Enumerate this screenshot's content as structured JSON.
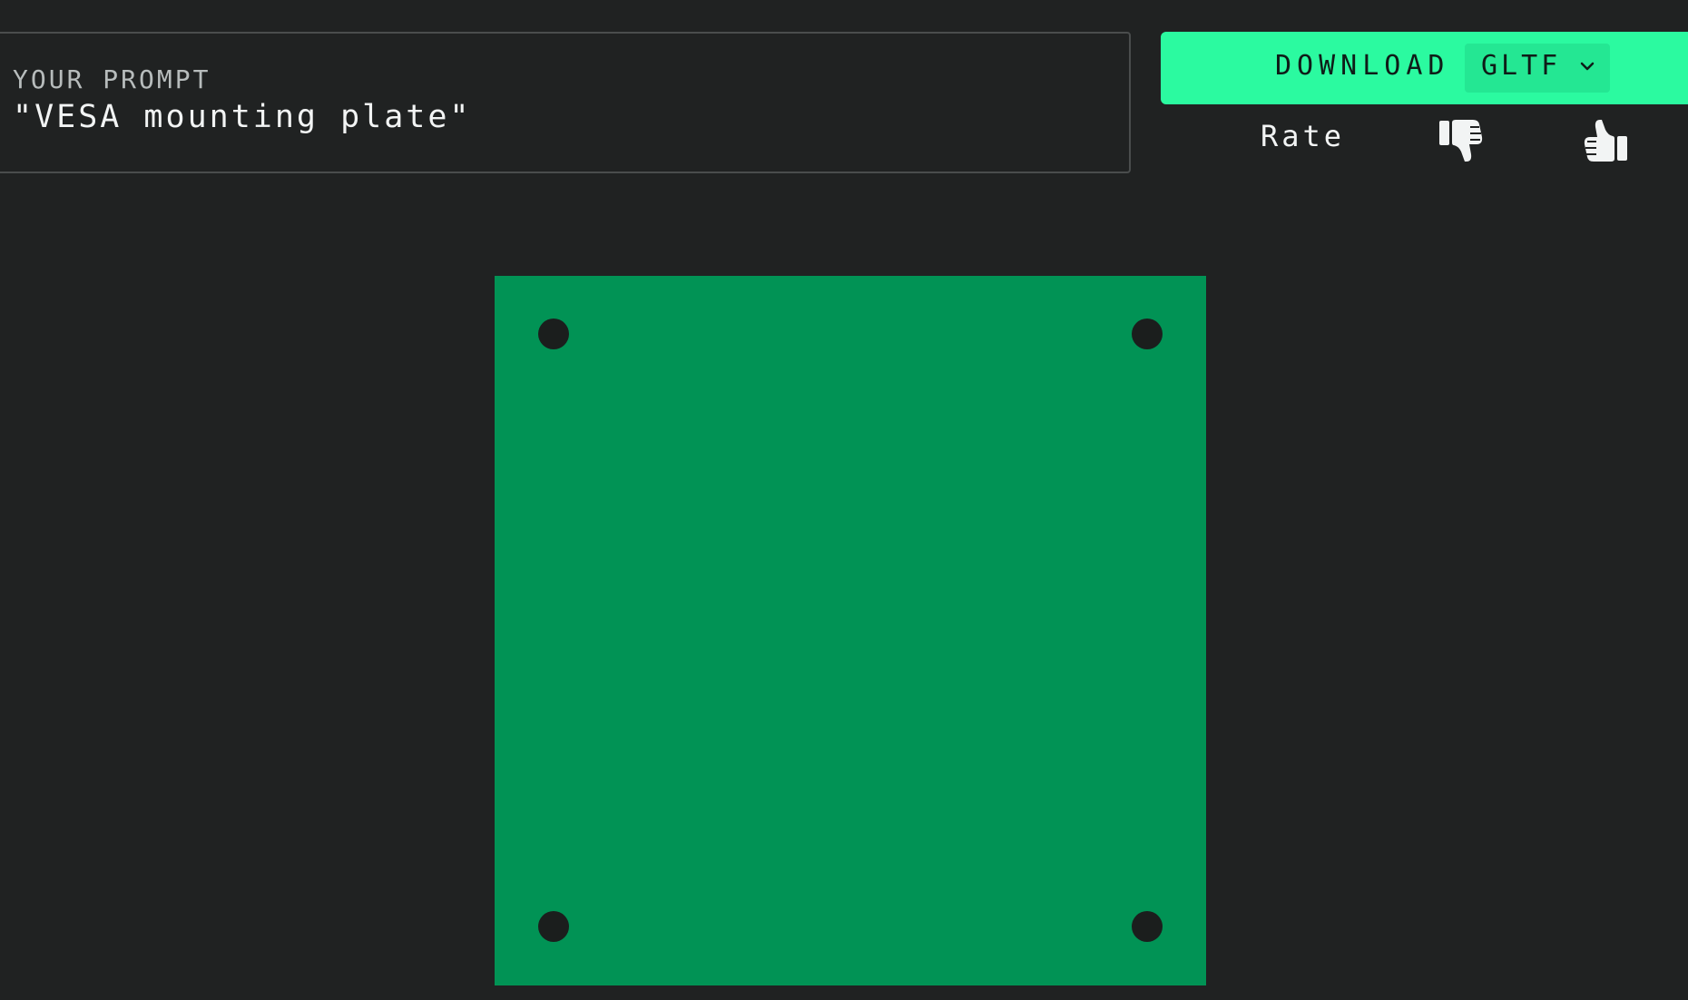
{
  "prompt": {
    "label": "YOUR PROMPT",
    "text": "\"VESA mounting plate\""
  },
  "download": {
    "label": "DOWNLOAD",
    "format": "GLTF",
    "icon": "chevron-down-icon"
  },
  "rating": {
    "label": "Rate",
    "down_icon": "thumbs-down-icon",
    "up_icon": "thumbs-up-icon"
  },
  "colors": {
    "background": "#202222",
    "accent": "#2bfaa0",
    "model": "#019355",
    "hole": "#1b1e1d"
  }
}
